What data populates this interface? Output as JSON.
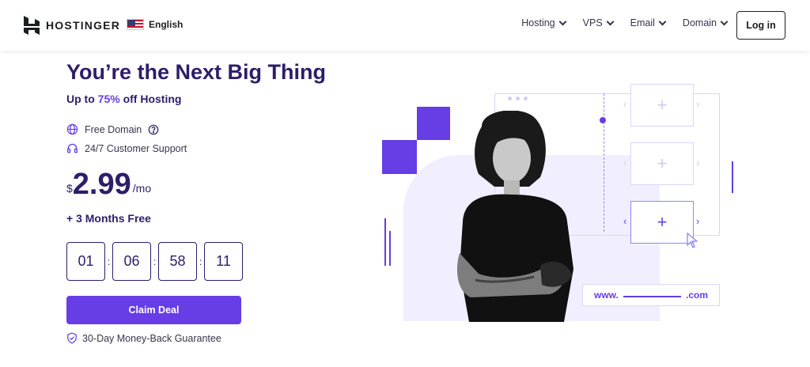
{
  "header": {
    "brand": "HOSTINGER",
    "language": "English",
    "nav": [
      "Hosting",
      "VPS",
      "Email",
      "Domain"
    ],
    "login_label": "Log in"
  },
  "hero": {
    "title": "You’re the Next Big Thing",
    "subtitle_prefix": "Up to ",
    "subtitle_highlight": "75%",
    "subtitle_suffix": " off Hosting",
    "features": [
      "Free Domain",
      "24/7 Customer Support"
    ],
    "price": {
      "currency": "$",
      "amount": "2.99",
      "period": "/mo"
    },
    "bonus": "+ 3 Months Free",
    "timer": [
      "01",
      "06",
      "58",
      "11"
    ],
    "cta_label": "Claim Deal",
    "guarantee": "30-Day Money-Back Guarantee"
  },
  "illustration": {
    "domain_prefix": "www.",
    "domain_suffix": ".com"
  },
  "colors": {
    "accent": "#673de6",
    "heading": "#2f1c6a",
    "lavender": "#f1efff"
  }
}
